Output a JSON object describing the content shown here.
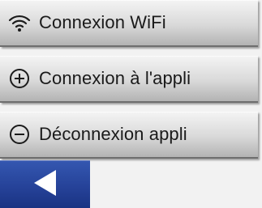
{
  "menu": {
    "items": [
      {
        "label": "Connexion WiFi",
        "icon": "wifi-icon"
      },
      {
        "label": "Connexion à l'appli",
        "icon": "plus-circle-icon"
      },
      {
        "label": "Déconnexion appli",
        "icon": "minus-circle-icon"
      }
    ]
  },
  "footer": {
    "back_icon": "back-arrow-icon"
  },
  "colors": {
    "back_button": "#2a469c",
    "text": "#1a1a1a",
    "background": "#f2f2f2"
  }
}
